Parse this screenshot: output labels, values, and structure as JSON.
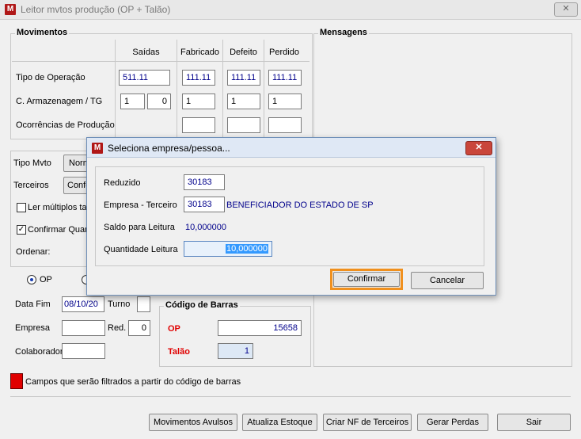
{
  "window": {
    "title": "Leitor mvtos produção (OP + Talão)",
    "close_glyph": "✕",
    "icon_letter": "M"
  },
  "movimentos": {
    "title": "Movimentos",
    "headers": [
      "Saídas",
      "Fabricado",
      "Defeito",
      "Perdido"
    ],
    "row_tipo": {
      "label": "Tipo de Operação",
      "values": [
        "511.11",
        "111.11",
        "111.11",
        "111.11"
      ]
    },
    "row_arm": {
      "label": "C. Armazenagem / TG",
      "saidas_a": "1",
      "saidas_b": "0",
      "values": [
        "1",
        "1",
        "1"
      ]
    },
    "row_ocor": {
      "label": "Ocorrências de Produção"
    }
  },
  "mensagens": {
    "title": "Mensagens"
  },
  "options": {
    "tipo_mvto_label": "Tipo Mvto",
    "tipo_mvto_value": "Norm",
    "terceiros_label": "Terceiros",
    "terceiros_value": "Confo",
    "ler_multiplos_label": "Ler múltiplos talõ",
    "confirmar_label": "Confirmar Quan",
    "ordenar_label": "Ordenar:",
    "radio_op_label": "OP"
  },
  "filters": {
    "data_fim_label": "Data Fim",
    "data_fim_value": "08/10/20",
    "turno_label": "Turno",
    "empresa_label": "Empresa",
    "red_label": "Red.",
    "red_value": "0",
    "colaborador_label": "Colaborador"
  },
  "barcode": {
    "title": "Código de Barras",
    "op_label": "OP",
    "op_value": "15658",
    "talao_label": "Talão",
    "talao_value": "1"
  },
  "legend_text": "Campos que serão filtrados a partir do código de barras",
  "buttons": {
    "avulsos": "Movimentos Avulsos",
    "estoque": "Atualiza Estoque",
    "nf": "Criar NF de Terceiros",
    "perdas": "Gerar Perdas",
    "sair": "Sair"
  },
  "dialog": {
    "title": "Seleciona empresa/pessoa...",
    "reduzido_label": "Reduzido",
    "reduzido_value": "30183",
    "empresa_label": "Empresa - Terceiro",
    "empresa_value": "30183",
    "empresa_name": "BENEFICIADOR DO ESTADO DE SP",
    "saldo_label": "Saldo para Leitura",
    "saldo_value": "10,000000",
    "qtd_label": "Quantidade Leitura",
    "qtd_value": "10,000000",
    "confirm": "Confirmar",
    "cancel": "Cancelar",
    "close_glyph": "✕"
  },
  "colors": {
    "accent_red": "#e00000",
    "focus_orange": "#f0901e",
    "selection_blue": "#3399ff"
  }
}
